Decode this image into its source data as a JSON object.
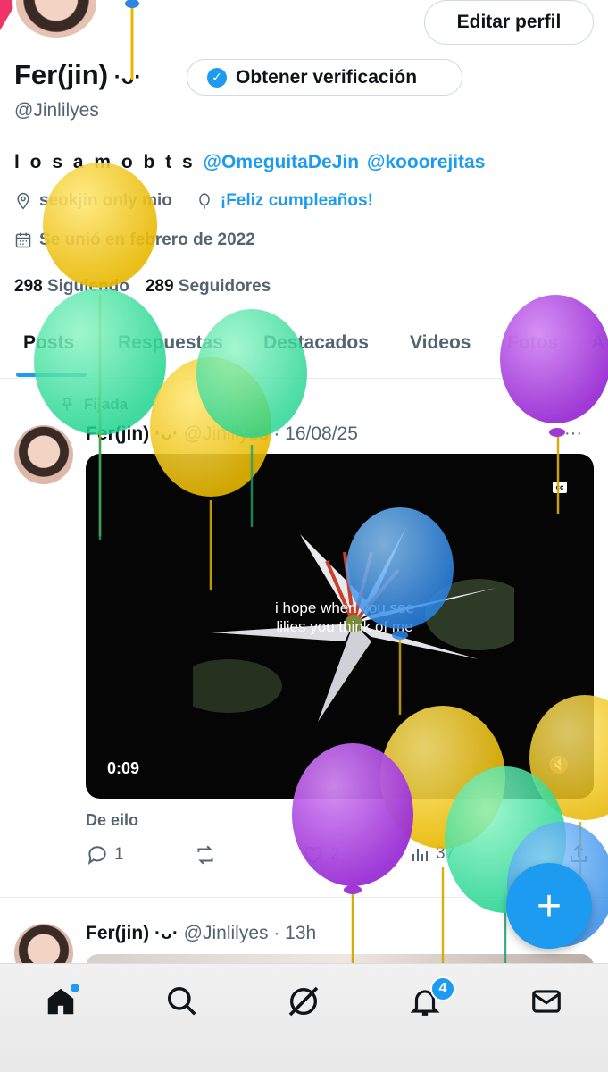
{
  "profile": {
    "edit_label": "Editar perfil",
    "name": "Fer(jin)",
    "name_suffix": " ·ᴗ·",
    "verify_label": "Obtener verificación",
    "handle": "@Jinlilyes",
    "bio_text": "l o s a m o b t s ",
    "bio_mention_1": "@OmeguitaDeJin",
    "bio_mention_2": "@kooorejitas",
    "location": "seokjin only mio",
    "birthday": "¡Feliz cumpleaños!",
    "joined": "Se unió en febrero de 2022",
    "following_count": "298",
    "following_label": "Siguiendo",
    "followers_count": "289",
    "followers_label": "Seguidores"
  },
  "tabs": [
    "Posts",
    "Respuestas",
    "Destacados",
    "Videos",
    "Fotos",
    "A"
  ],
  "pinned_label": "Fijada",
  "post1": {
    "name": "Fer(jin)",
    "name_suffix": " ·ᴗ·",
    "handle_date": "@Jinlilyes · 16/08/25",
    "video_caption": "i hope when you see lilies you think of me",
    "video_time": "0:09",
    "from_label": "De eilo",
    "replies": "1",
    "likes": "2",
    "views": "37"
  },
  "post2": {
    "name": "Fer(jin)",
    "name_suffix": " ·ᴗ·",
    "handle_date": "@Jinlilyes · 13h"
  },
  "nav": {
    "notifications_badge": "4"
  },
  "colors": {
    "accent": "#1d9bf0",
    "text": "#0f1419",
    "secondary": "#536471"
  },
  "icons": [
    "home-icon",
    "search-icon",
    "grok-icon",
    "bell-icon",
    "mail-icon",
    "plus-icon"
  ]
}
